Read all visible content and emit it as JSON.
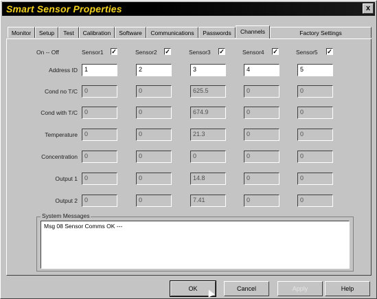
{
  "window": {
    "title": "Smart Sensor Properties",
    "close_label": "x"
  },
  "tabs": [
    "Monitor",
    "Setup",
    "Test",
    "Calibration",
    "Software",
    "Communications",
    "Passwords",
    "Channels",
    "Factory Settings"
  ],
  "active_tab": "Channels",
  "onoff_label": "On -- Off",
  "sensors": [
    {
      "label": "Sensor1",
      "checked": true
    },
    {
      "label": "Sensor2",
      "checked": true
    },
    {
      "label": "Sensor3",
      "checked": true
    },
    {
      "label": "Sensor4",
      "checked": true
    },
    {
      "label": "Sensor5",
      "checked": true
    }
  ],
  "check_mark": "✓",
  "rows": [
    {
      "label": "Address ID",
      "values": [
        "1",
        "2",
        "3",
        "4",
        "5"
      ]
    },
    {
      "label": "Cond no T/C",
      "values": [
        "0",
        "0",
        "625.5",
        "0",
        "0"
      ]
    },
    {
      "label": "Cond with T/C",
      "values": [
        "0",
        "0",
        "674.9",
        "0",
        "0"
      ]
    },
    {
      "label": "Temperature",
      "values": [
        "0",
        "0",
        "21.3",
        "0",
        "0"
      ]
    },
    {
      "label": "Concentration",
      "values": [
        "0",
        "0",
        "0",
        "0",
        "0"
      ]
    },
    {
      "label": "Output 1",
      "values": [
        "0",
        "0",
        "14.8",
        "0",
        "0"
      ]
    },
    {
      "label": "Output 2",
      "values": [
        "0",
        "0",
        "7.41",
        "0",
        "0"
      ]
    }
  ],
  "system_messages": {
    "label": "System Messages",
    "text": "Msg 08 Sensor Comms OK ---"
  },
  "buttons": {
    "ok": "OK",
    "cancel": "Cancel",
    "apply": "Apply",
    "help": "Help"
  },
  "colors": {
    "title_text": "#f2d21e",
    "titlebar": "#000000",
    "face": "#c4c4c4"
  }
}
